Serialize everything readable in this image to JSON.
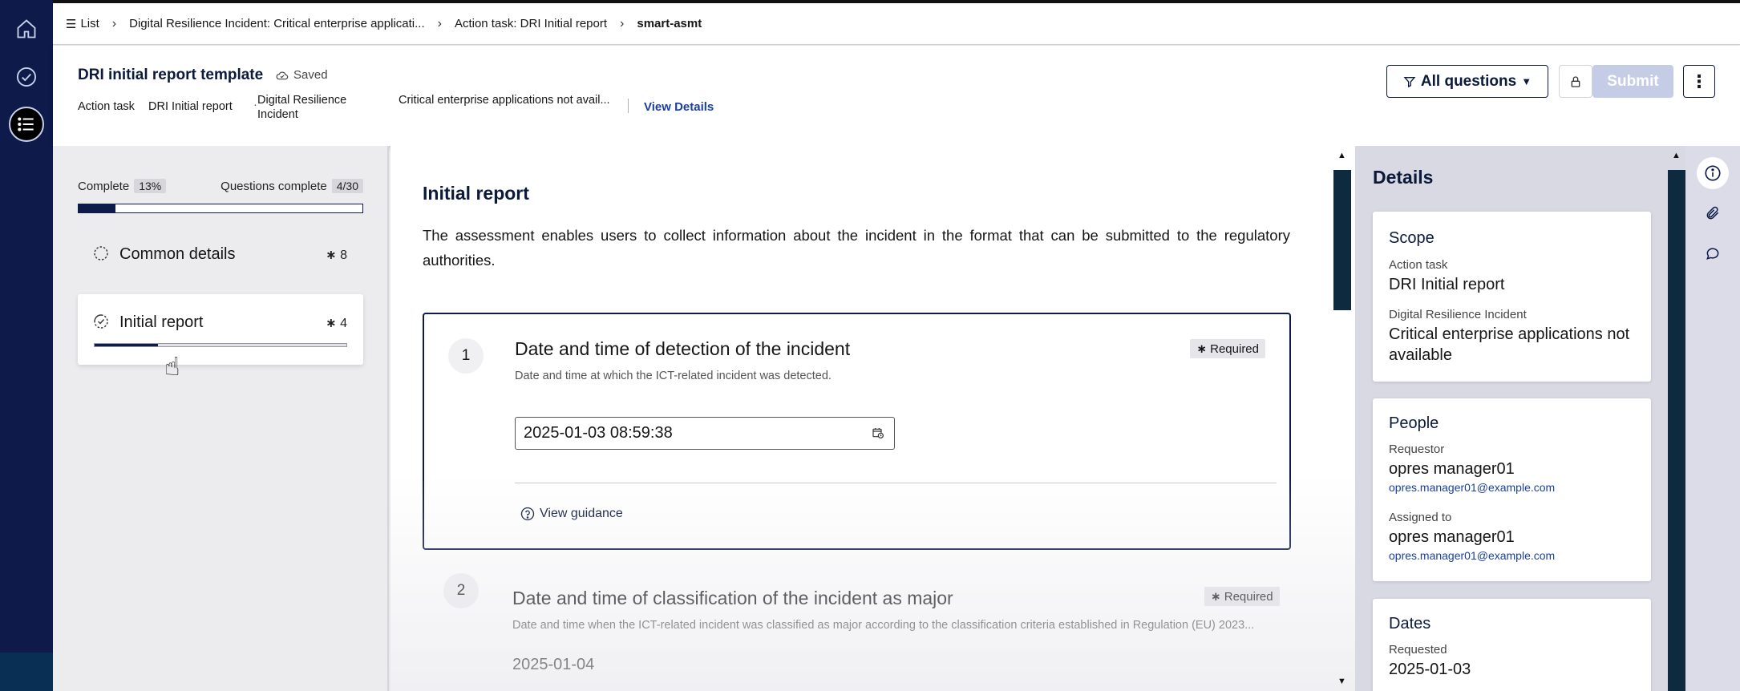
{
  "rail": {
    "icons": [
      "home-icon",
      "check-circle-icon",
      "list-icon"
    ]
  },
  "breadcrumb": {
    "items": [
      {
        "label": "List"
      },
      {
        "label": "Digital Resilience Incident: Critical enterprise applicati..."
      },
      {
        "label": "Action task: DRI Initial report"
      },
      {
        "label": "smart-asmt"
      }
    ]
  },
  "header": {
    "title": "DRI initial report template",
    "saved": "Saved",
    "action_task_label": "Action task",
    "action_task_value": "DRI Initial report",
    "incident_label_line1": "Digital Resilience",
    "incident_label_line2": "Incident",
    "incident_value": "Critical enterprise applications not avail...",
    "view_details": "View Details",
    "filter_label": "All questions",
    "submit_label": "Submit"
  },
  "progress": {
    "complete_label": "Complete",
    "complete_pct": "13%",
    "complete_fraction": 0.13,
    "questions_label": "Questions complete",
    "questions_value": "4/30"
  },
  "sections": [
    {
      "label": "Common details",
      "count": "8",
      "progress": 0
    },
    {
      "label": "Initial report",
      "count": "4",
      "progress": 0.25
    }
  ],
  "main": {
    "title": "Initial report",
    "description": "The assessment enables users to collect information about the incident in the format that can be submitted to the regulatory authorities.",
    "questions": [
      {
        "number": "1",
        "title": "Date and time of detection of the incident",
        "description": "Date and time at which the ICT-related incident was detected.",
        "required": "Required",
        "value": "2025-01-03 08:59:38",
        "guidance": "View guidance"
      },
      {
        "number": "2",
        "title": "Date and time of classification of the incident as major",
        "description": "Date and time when the ICT-related incident was classified as major according to the classification criteria established in Regulation (EU) 2023...",
        "required": "Required",
        "value": "2025-01-04"
      }
    ]
  },
  "details": {
    "title": "Details",
    "scope": {
      "heading": "Scope",
      "action_task_label": "Action task",
      "action_task_value": "DRI Initial report",
      "incident_label": "Digital Resilience Incident",
      "incident_value": "Critical enterprise applications not available"
    },
    "people": {
      "heading": "People",
      "requestor_label": "Requestor",
      "requestor_name": "opres manager01",
      "requestor_email": "opres.manager01@example.com",
      "assigned_label": "Assigned to",
      "assigned_name": "opres manager01",
      "assigned_email": "opres.manager01@example.com"
    },
    "dates": {
      "heading": "Dates",
      "requested_label": "Requested",
      "requested_value": "2025-01-03"
    }
  },
  "colors": {
    "navy": "#0d1a4a",
    "link": "#1a3f9c",
    "submit_disabled": "#c5cde6"
  }
}
